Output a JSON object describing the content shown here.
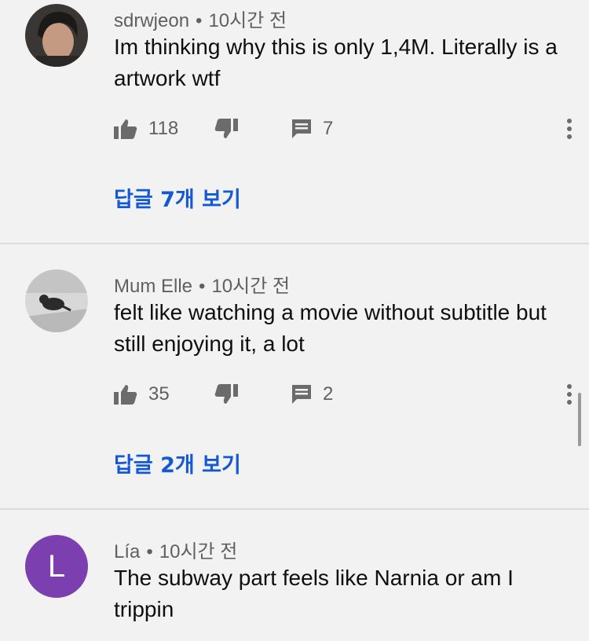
{
  "comments": [
    {
      "author": "sdrwjeon",
      "separator": "•",
      "time": "10시간 전",
      "text": "Im thinking why this is only 1,4M. Literally is a artwork wtf",
      "likes": "118",
      "reply_count": "7",
      "view_replies": "답글 7개 보기",
      "avatar": "photo-person-icon"
    },
    {
      "author": "Mum Elle",
      "separator": "•",
      "time": "10시간 전",
      "text": "felt like watching a movie without subtitle but still enjoying it, a lot",
      "likes": "35",
      "reply_count": "2",
      "view_replies": "답글 2개 보기",
      "avatar": "photo-cat-icon"
    },
    {
      "author": "Lía",
      "separator": "•",
      "time": "10시간 전",
      "text": "The subway part feels like Narnia or am I trippin",
      "avatar_letter": "L",
      "avatar_color": "#7b3fb0"
    }
  ],
  "colors": {
    "background": "#f2f2f2",
    "link": "#1558d6",
    "meta": "#606060"
  }
}
